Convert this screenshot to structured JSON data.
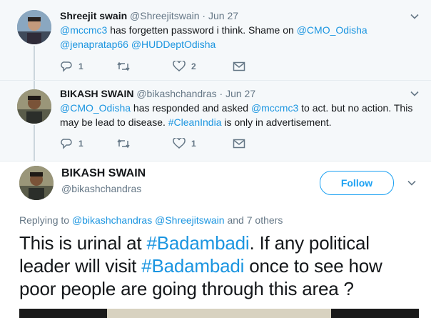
{
  "tweets": [
    {
      "name": "Shreejit swain",
      "handle": "@Shreejitswain",
      "separator": "·",
      "date": "Jun 27",
      "segments": [
        {
          "t": "@mccmc3",
          "link": true
        },
        {
          "t": " has forgetten password i think. Shame on ",
          "link": false
        },
        {
          "t": "@CMO_Odisha",
          "link": true
        },
        {
          "t": " ",
          "link": false
        },
        {
          "t": "@jenapratap66",
          "link": true
        },
        {
          "t": " ",
          "link": false
        },
        {
          "t": "@HUDDeptOdisha",
          "link": true
        }
      ],
      "reply_count": "1",
      "retweet_count": "",
      "like_count": "2"
    },
    {
      "name": "BIKASH SWAIN",
      "handle": "@bikashchandras",
      "separator": "·",
      "date": "Jun 27",
      "segments": [
        {
          "t": "@CMO_Odisha",
          "link": true
        },
        {
          "t": " has responded and asked ",
          "link": false
        },
        {
          "t": "@mccmc3",
          "link": true
        },
        {
          "t": " to act. but no action. This may be lead to disease. ",
          "link": false
        },
        {
          "t": "#CleanIndia",
          "link": true
        },
        {
          "t": " is only in advertisement.",
          "link": false
        }
      ],
      "reply_count": "1",
      "retweet_count": "",
      "like_count": "1"
    }
  ],
  "main": {
    "name": "BIKASH SWAIN",
    "handle": "@bikashchandras",
    "follow_label": "Follow",
    "replying_prefix": "Replying to ",
    "replying_users": [
      "@bikashchandras",
      "@Shreejitswain"
    ],
    "replying_suffix": " and 7 others",
    "segments": [
      {
        "t": "This is urinal at ",
        "link": false
      },
      {
        "t": "#Badambadi",
        "link": true
      },
      {
        "t": ". If any political leader will visit ",
        "link": false
      },
      {
        "t": "#Badambadi",
        "link": true
      },
      {
        "t": " once to see how poor people are going through this area ?",
        "link": false
      }
    ]
  },
  "icons": {
    "reply": "reply-icon",
    "retweet": "retweet-icon",
    "like": "heart-icon",
    "dm": "envelope-icon",
    "caret": "chevron-down-icon"
  },
  "colors": {
    "link": "#1b95e0",
    "accent": "#1da1f2",
    "muted": "#657786",
    "context_bg": "#f5f8fa"
  }
}
